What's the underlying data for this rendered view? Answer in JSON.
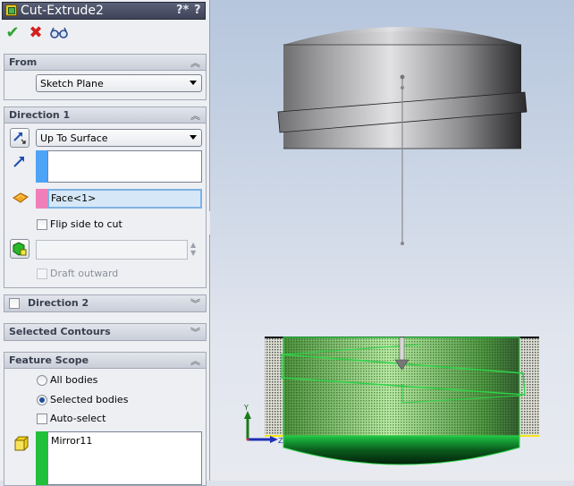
{
  "property_manager": {
    "title": "Cut-Extrude2",
    "title_icon": "cut-extrude-feature-icon",
    "help_buttons": [
      "?*",
      "?"
    ],
    "toolbar": {
      "ok_icon": "checkmark-icon",
      "cancel_icon": "x-icon",
      "preview_icon": "glasses-icon",
      "ok_glyph": "✔",
      "cancel_glyph": "✖",
      "preview_glyph": "👓"
    },
    "sections": {
      "from": {
        "label": "From",
        "chevron": "︽",
        "start_condition": "Sketch Plane"
      },
      "direction1": {
        "label": "Direction 1",
        "chevron": "︽",
        "end_condition": "Up To Surface",
        "direction_selection": "",
        "face_selection": "Face<1>",
        "flip_side_to_cut_label": "Flip side to cut",
        "flip_side_to_cut_checked": false,
        "draft_value": "",
        "draft_outward_label": "Draft outward",
        "draft_outward_checked": false,
        "direction_color": "#4da3f5",
        "face_color": "#f07fb9"
      },
      "direction2": {
        "label": "Direction 2",
        "chevron": "︾",
        "checked": false
      },
      "selected_contours": {
        "label": "Selected Contours",
        "chevron": "︾"
      },
      "feature_scope": {
        "label": "Feature Scope",
        "chevron": "︽",
        "all_bodies_label": "All bodies",
        "selected_bodies_label": "Selected bodies",
        "selected_option": "Selected bodies",
        "auto_select_label": "Auto-select",
        "auto_select_checked": false,
        "bodies": [
          "Mirror11"
        ],
        "bodies_color": "#22c03a"
      }
    }
  },
  "viewport": {
    "triad": {
      "y_label": "Y",
      "z_label": "Z"
    },
    "bottom_text": "*"
  }
}
